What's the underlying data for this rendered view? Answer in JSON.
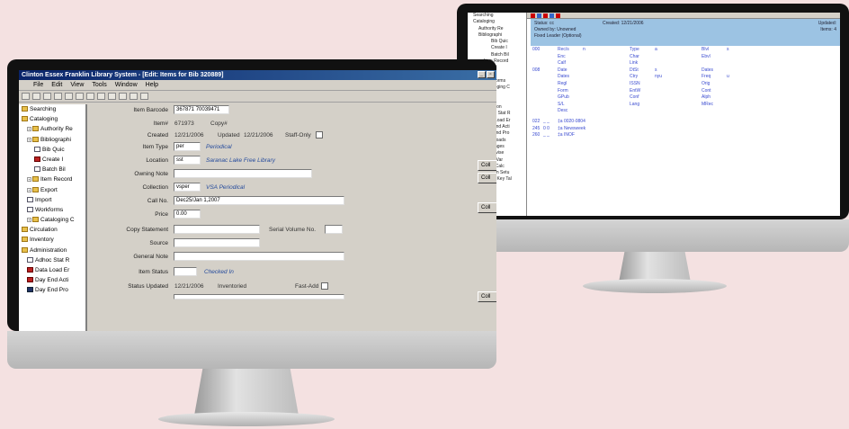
{
  "back_screen": {
    "tree": [
      "Searching",
      "Cataloging",
      "Authority Re",
      "Bibliographi",
      "Bib Quic",
      "Create I",
      "Batch Bil",
      "Item Record",
      "Export",
      "Import",
      "Workforms",
      "Cataloging C",
      "Circulation",
      "Inventory",
      "Administration",
      "Adhoc Stat R",
      "Data Load Er",
      "Day End Acti",
      "Day End Pro",
      "Lost Loads",
      "Messages",
      "Supervise",
      "Fixed Var",
      "Days Calc",
      "System Setu",
      "Reset Key Tal"
    ],
    "header": {
      "status": "Status: cc",
      "created": "Created: 12/21/2006",
      "owned": "Owned by: Unowned",
      "fixed": "Fixed Leader (Optional)",
      "updated": "Updated:",
      "items": "Items: 4"
    },
    "rows": [
      {
        "tag": "000",
        "cols": [
          "Rec/s",
          "n",
          "Type",
          "a",
          "Blvl",
          "s"
        ]
      },
      {
        "tag": "",
        "cols": [
          "Enc",
          "",
          "Char",
          "",
          "Ebvl",
          ""
        ]
      },
      {
        "tag": "",
        "cols": [
          "Calf",
          "",
          "Link",
          "",
          "",
          ""
        ]
      },
      {
        "tag": "008",
        "cols": [
          "Date",
          "",
          "DtSt",
          "s",
          "Dates",
          ""
        ]
      },
      {
        "tag": "",
        "cols": [
          "Dates",
          "",
          "Ctry",
          "nyu",
          "Freq",
          "u"
        ]
      },
      {
        "tag": "",
        "cols": [
          "Regl",
          "",
          "ISSN",
          "",
          "Orig",
          ""
        ]
      },
      {
        "tag": "",
        "cols": [
          "Form",
          "",
          "EntW",
          "",
          "Cont",
          ""
        ]
      },
      {
        "tag": "",
        "cols": [
          "GPub",
          "",
          "Conf",
          "",
          "Alph",
          ""
        ]
      },
      {
        "tag": "",
        "cols": [
          "S/L",
          "",
          "Lang",
          "",
          "MRec",
          ""
        ]
      },
      {
        "tag": "",
        "cols": [
          "Desc",
          "",
          "",
          "",
          "",
          ""
        ]
      }
    ],
    "fields": [
      {
        "tag": "022",
        "ind": "_ _",
        "text": "‡a 0020-0804"
      },
      {
        "tag": "245",
        "ind": "0 0",
        "text": "‡a Newsweek"
      },
      {
        "tag": "260",
        "ind": "_ _",
        "text": "‡a INOF"
      }
    ]
  },
  "front_screen": {
    "window_title": "Clinton Essex Franklin Library System - [Edit: Items for Bib 320889]",
    "menu": [
      "File",
      "Edit",
      "View",
      "Tools",
      "Window",
      "Help"
    ],
    "tree": [
      {
        "label": "Searching",
        "level": 0,
        "icon": "folder"
      },
      {
        "label": "Cataloging",
        "level": 0,
        "icon": "folder"
      },
      {
        "label": "Authority Re",
        "level": 1,
        "icon": "folder"
      },
      {
        "label": "Bibliographi",
        "level": 1,
        "icon": "folder"
      },
      {
        "label": "Bib Quic",
        "level": 2,
        "icon": "doc"
      },
      {
        "label": "Create I",
        "level": 2,
        "icon": "red"
      },
      {
        "label": "Batch Bil",
        "level": 2,
        "icon": "doc"
      },
      {
        "label": "Item Record",
        "level": 1,
        "icon": "folder"
      },
      {
        "label": "Export",
        "level": 1,
        "icon": "folder"
      },
      {
        "label": "Import",
        "level": 1,
        "icon": "doc"
      },
      {
        "label": "Workforms",
        "level": 1,
        "icon": "doc"
      },
      {
        "label": "Cataloging C",
        "level": 1,
        "icon": "folder"
      },
      {
        "label": "Circulation",
        "level": 0,
        "icon": "folder"
      },
      {
        "label": "Inventory",
        "level": 0,
        "icon": "folder"
      },
      {
        "label": "Administration",
        "level": 0,
        "icon": "folder"
      },
      {
        "label": "Adhoc Stat R",
        "level": 1,
        "icon": "doc"
      },
      {
        "label": "Data Load Er",
        "level": 1,
        "icon": "red"
      },
      {
        "label": "Day End Acti",
        "level": 1,
        "icon": "red"
      },
      {
        "label": "Day End Pro",
        "level": 1,
        "icon": "blue"
      }
    ],
    "form": {
      "barcode_label": "Item Barcode",
      "barcode_value": "367871 70039471",
      "itemno_label": "Item#",
      "itemno_value": "671973",
      "copy_label": "Copy#",
      "created_label": "Created",
      "created_value": "12/21/2006",
      "updated_label": "Updated",
      "updated_value": "12/21/2006",
      "staffonly_label": "Staff-Only",
      "itemtype_label": "Item Type",
      "itemtype_value": "per",
      "itemtype_desc": "Periodical",
      "location_label": "Location",
      "location_value": "sst",
      "location_desc": "Saranac Lake Free Library",
      "owning_label": "Owning Note",
      "collection_label": "Collection",
      "collection_value": "vsper",
      "collection_desc": "VSA Periodical",
      "callno_label": "Call No.",
      "callno_value": "Dec25/Jan 1,2007",
      "price_label": "Price",
      "price_value": "0.00",
      "copystatement_label": "Copy Statement",
      "serialvol_label": "Serial Volume No.",
      "source_label": "Source",
      "generalnote_label": "General Note",
      "itemstatus_label": "Item Status",
      "itemstatus_desc": "Checked In",
      "statusupdated_label": "Status Updated",
      "statusupdated_value": "12/21/2006",
      "inventoried_label": "Inventoried",
      "fastadd_label": "Fast-Add"
    },
    "side_buttons": [
      "Coll",
      "Coll",
      "Coll",
      "Coll"
    ]
  }
}
